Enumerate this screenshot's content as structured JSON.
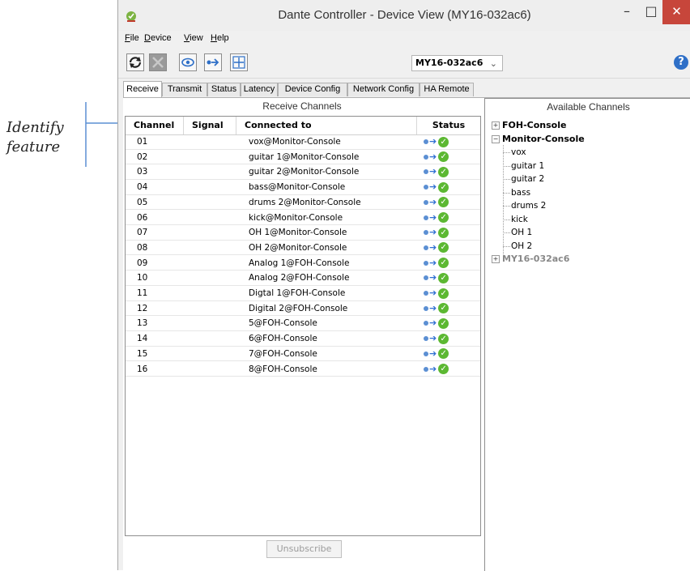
{
  "callout": {
    "text_line1": "Identify",
    "text_line2": "feature"
  },
  "window": {
    "title": "Dante Controller - Device View (MY16-032ac6)",
    "min_symbol": "–",
    "max_symbol": "□",
    "close_symbol": "✕"
  },
  "menu": {
    "file": "File",
    "device": "Device",
    "view": "View",
    "help": "Help"
  },
  "toolbar": {
    "device_selected": "MY16-032ac6",
    "help_symbol": "?"
  },
  "tabs": [
    "Receive",
    "Transmit",
    "Status",
    "Latency",
    "Device Config",
    "Network Config",
    "HA Remote"
  ],
  "receive": {
    "title": "Receive Channels",
    "columns": {
      "channel": "Channel",
      "signal": "Signal",
      "connected": "Connected to",
      "status": "Status"
    },
    "rows": [
      {
        "channel": "01",
        "connected": "vox@Monitor-Console"
      },
      {
        "channel": "02",
        "connected": "guitar 1@Monitor-Console"
      },
      {
        "channel": "03",
        "connected": "guitar 2@Monitor-Console"
      },
      {
        "channel": "04",
        "connected": "bass@Monitor-Console"
      },
      {
        "channel": "05",
        "connected": "drums 2@Monitor-Console"
      },
      {
        "channel": "06",
        "connected": "kick@Monitor-Console"
      },
      {
        "channel": "07",
        "connected": "OH 1@Monitor-Console"
      },
      {
        "channel": "08",
        "connected": "OH 2@Monitor-Console"
      },
      {
        "channel": "09",
        "connected": "Analog 1@FOH-Console"
      },
      {
        "channel": "10",
        "connected": "Analog 2@FOH-Console"
      },
      {
        "channel": "11",
        "connected": "Digtal 1@FOH-Console"
      },
      {
        "channel": "12",
        "connected": "Digital 2@FOH-Console"
      },
      {
        "channel": "13",
        "connected": "5@FOH-Console"
      },
      {
        "channel": "14",
        "connected": "6@FOH-Console"
      },
      {
        "channel": "15",
        "connected": "7@FOH-Console"
      },
      {
        "channel": "16",
        "connected": "8@FOH-Console"
      }
    ],
    "unsubscribe_label": "Unsubscribe"
  },
  "available": {
    "title": "Available Channels",
    "devices": [
      {
        "name": "FOH-Console",
        "expanded": false,
        "children": []
      },
      {
        "name": "Monitor-Console",
        "expanded": true,
        "children": [
          "vox",
          "guitar 1",
          "guitar 2",
          "bass",
          "drums 2",
          "kick",
          "OH 1",
          "OH 2"
        ]
      },
      {
        "name": "MY16-032ac6",
        "expanded": false,
        "children": []
      }
    ]
  },
  "colors": {
    "close_button": "#c7463b",
    "status_ok": "#5cb832",
    "arrow": "#2f6fd2",
    "help": "#2e6fc7"
  },
  "icons": {
    "status_ok": "check-circle-icon",
    "flow": "arrow-right-icon"
  }
}
